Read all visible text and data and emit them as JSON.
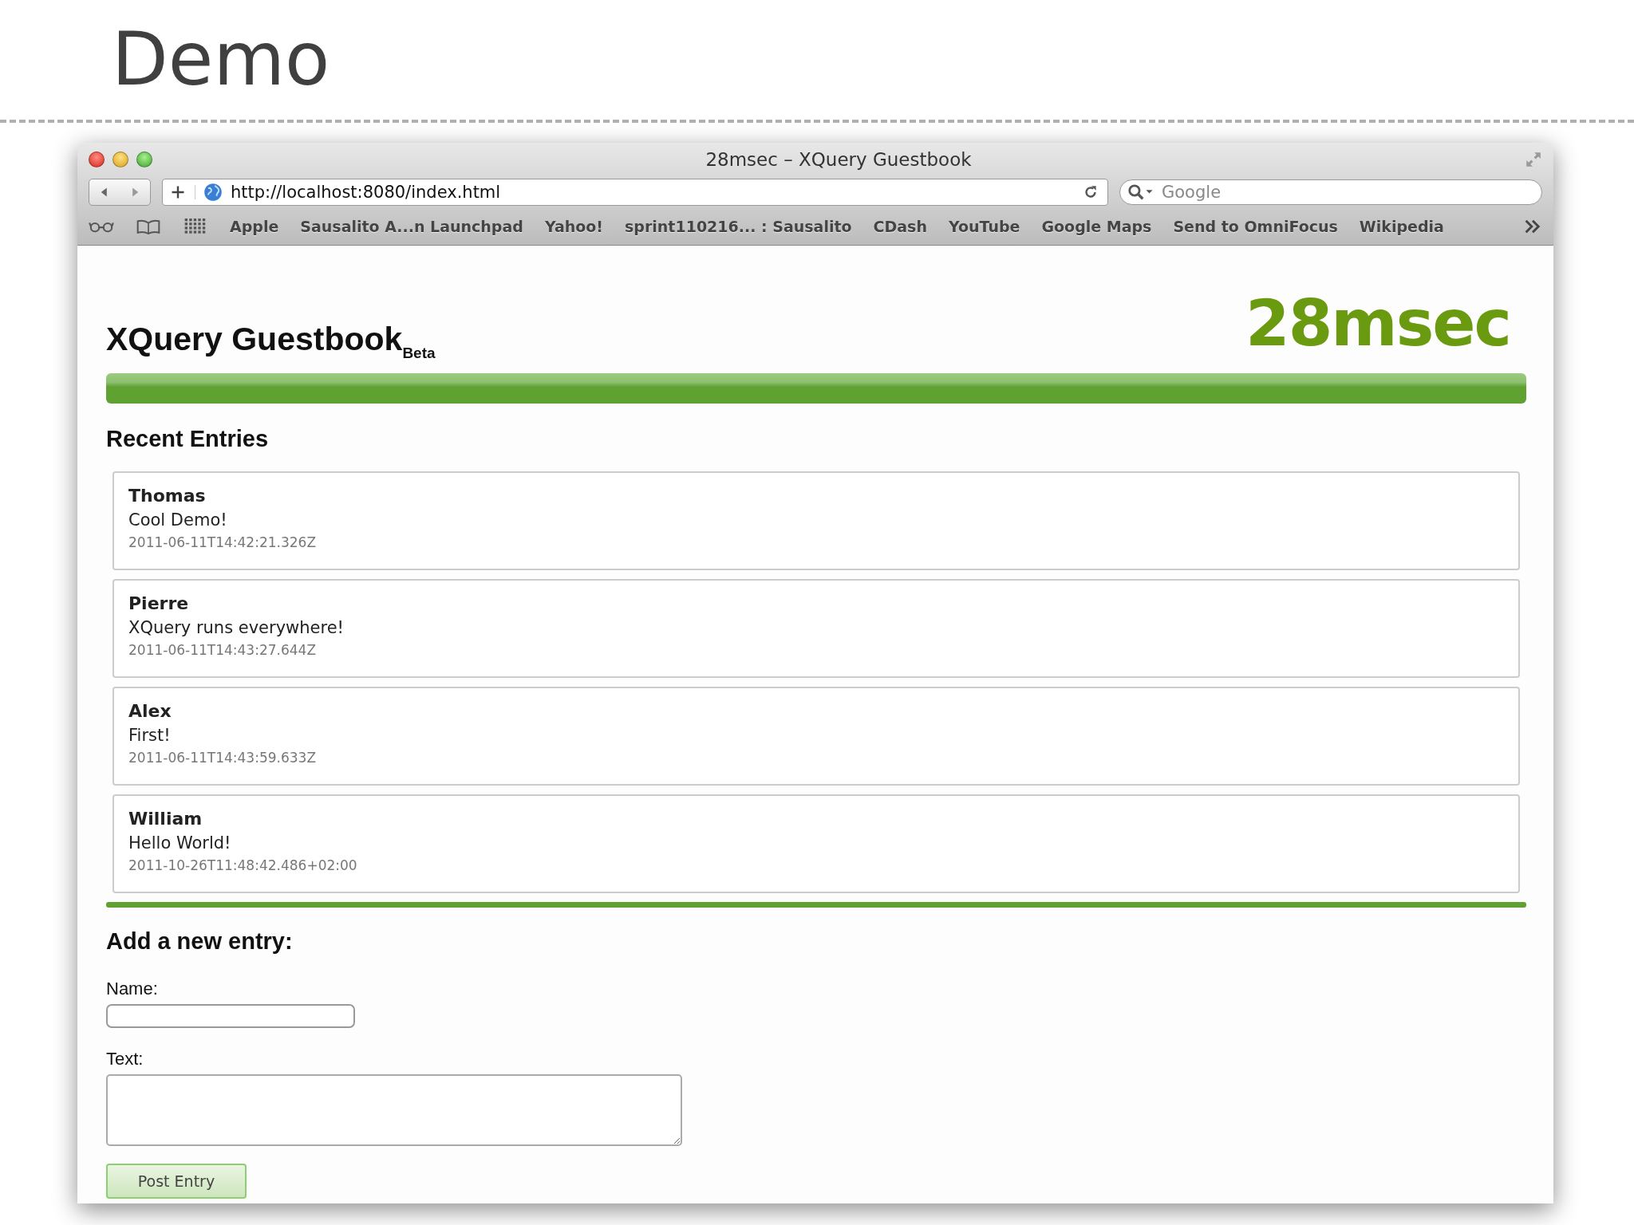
{
  "slide": {
    "title": "Demo"
  },
  "browser": {
    "title": "28msec – XQuery Guestbook",
    "url": "http://localhost:8080/index.html",
    "search": {
      "placeholder": "Google"
    },
    "bookmarks": [
      "Apple",
      "Sausalito A...n Launchpad",
      "Yahoo!",
      "sprint110216... : Sausalito",
      "CDash",
      "YouTube",
      "Google Maps",
      "Send to OmniFocus",
      "Wikipedia"
    ]
  },
  "page": {
    "heading": "XQuery Guestbook",
    "heading_sub": "Beta",
    "logo": "28msec",
    "section_title": "Recent Entries",
    "entries": [
      {
        "name": "Thomas",
        "text": "Cool Demo!",
        "timestamp": "2011-06-11T14:42:21.326Z"
      },
      {
        "name": "Pierre",
        "text": "XQuery runs everywhere!",
        "timestamp": "2011-06-11T14:43:27.644Z"
      },
      {
        "name": "Alex",
        "text": "First!",
        "timestamp": "2011-06-11T14:43:59.633Z"
      },
      {
        "name": "William",
        "text": "Hello World!",
        "timestamp": "2011-10-26T11:48:42.486+02:00"
      }
    ],
    "form": {
      "heading": "Add a new entry:",
      "fields": [
        {
          "label": "Name:",
          "kind": "input"
        },
        {
          "label": "Text:",
          "kind": "textarea"
        }
      ],
      "button": "Post Entry"
    }
  }
}
